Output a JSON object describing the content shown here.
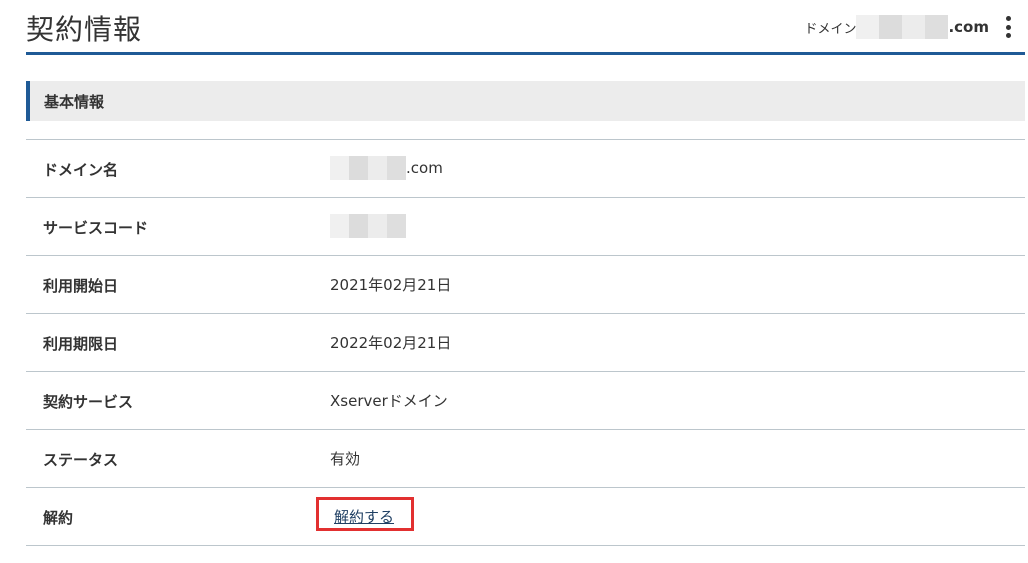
{
  "header": {
    "title": "契約情報",
    "domain_label": "ドメイン",
    "domain_tld": ".com",
    "menu_icon": "kebab-menu-icon"
  },
  "section": {
    "title": "基本情報"
  },
  "rows": [
    {
      "label": "ドメイン名",
      "value": ".com"
    },
    {
      "label": "サービスコード",
      "value": ""
    },
    {
      "label": "利用開始日",
      "value": "2021年02月21日"
    },
    {
      "label": "利用期限日",
      "value": "2022年02月21日"
    },
    {
      "label": "契約サービス",
      "value": "Xserverドメイン"
    },
    {
      "label": "ステータス",
      "value": "有効"
    },
    {
      "label": "解約",
      "link": "解約する"
    }
  ],
  "colors": {
    "accent": "#1f5a96",
    "highlight": "#e23030",
    "section_bg": "#ececec",
    "divider": "#bcc6cc"
  }
}
